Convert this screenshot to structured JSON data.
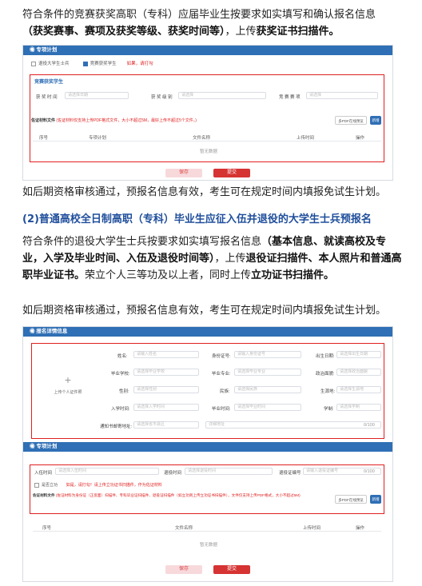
{
  "para1": {
    "line1": "符合条件的竞赛获奖高职（专科）应届毕业生按要求如实填写和确认报名信息",
    "line2_b1": "（获奖赛事、赛项及获奖等级、获奖时间等）",
    "line2_mid": "，上传",
    "line2_b2": "获奖证书扫描件。"
  },
  "shot1": {
    "bar_title": "专项计划",
    "chk1": "退役大学生士兵",
    "chk2": "竞赛获奖学生",
    "chk_hint": "如果，请打勾",
    "section_title": "竞赛获奖学生",
    "field1_label": "获 奖 时 间",
    "field1_placeholder": "请选择日期",
    "field2_label": "获 奖 级 别",
    "field2_placeholder": "请选择",
    "field3_label": "竞 赛 赛 项",
    "field3_placeholder": "请选择",
    "file_label": "佐证材料文件",
    "file_hint": "(佐证材料仅支持上传PDF格式文件，大小不超过5M，最好上传不超过5个文件。)",
    "btn_preview": "多PDF在线预览",
    "btn_add": "新增",
    "cols": [
      "序号",
      "专项计划",
      "文件名称",
      "上传时间",
      "操作"
    ],
    "empty": "暂无数据",
    "save": "保存",
    "submit": "提交"
  },
  "para2": "如后期资格审核通过，预报名信息有效，考生可在规定时间内填报免试生计划。",
  "heading": "(2)普通高校全日制高职（专科）毕业生应征入伍并退役的大学生士兵预报名",
  "para3": {
    "t1": "符合条件的退役大学生士兵按要求如实填写报名信息",
    "b1": "（基本信息、就读高校及专业，入学及毕业时间、入伍及退役时间等）",
    "t2": "，上传",
    "b2": "退役证扫描件、本人照片和普通高职毕业证书。",
    "t3": "荣立个人三等功及以上者，同时上传",
    "b3": "立功证书扫描件。"
  },
  "para4": "如后期资格审核通过，预报名信息有效，考生可在规定时间内填报免试生计划。",
  "shot2": {
    "bar_title": "报名详情信息",
    "photo_plus": "+",
    "photo_label": "上传个人证件照",
    "row1": [
      [
        "姓名:",
        "请输入姓名"
      ],
      [
        "身份证号:",
        "请输入身份证号"
      ],
      [
        "出生日期:",
        "请选择出生日期"
      ]
    ],
    "row2": [
      [
        "毕业学校:",
        "请选择毕业学校"
      ],
      [
        "毕业专业:",
        "请选择毕业专业"
      ],
      [
        "政治面貌:",
        "请选择政治面貌"
      ]
    ],
    "row3": [
      [
        "性别:",
        "请选择性别"
      ],
      [
        "民族:",
        "请选择民族"
      ],
      [
        "生源地:",
        "请选择生源地"
      ]
    ],
    "row4": [
      [
        "入学时间:",
        "请选择入学时间"
      ],
      [
        "毕业时间:",
        "请选择毕业时间"
      ],
      [
        "学制:",
        "请选择学制"
      ]
    ],
    "row5_label": "通知书邮寄地址:",
    "row5_sel": "请选择省市县区",
    "row5_input": "详细地址",
    "row5_count": "0/100",
    "bar2_title": "专项计划",
    "f1_label": "入伍时间",
    "f1_ph": "请选择入伍时间",
    "f2_label": "退役时间",
    "f2_ph": "请选择退役时间",
    "f3_label": "退役证编号",
    "f3_ph": "请输入退役证编号",
    "f3_count": "0/100",
    "merit_label": "是否立功",
    "merit_hint": "如是，请打勾！请上传立功证书扫描件，作为佐证材料",
    "file_label": "佐证材料文件",
    "file_hint": "(佐证材料为身份证（正反面）扫描件、专科毕业证扫描件、退役证扫描件（如立功则上传立功证书扫描件），文件仅支持上传PDF格式，大小不超过5M)",
    "btn_preview": "多PDF在线预览",
    "btn_add": "新增",
    "cols": [
      "序号",
      "文件名称",
      "上传时间",
      "操作"
    ],
    "empty": "暂无数据",
    "save": "保存",
    "submit": "提交"
  },
  "colors": {
    "accent": "#2f6fb5",
    "red": "#e02020",
    "heading": "#1f4e9c"
  }
}
